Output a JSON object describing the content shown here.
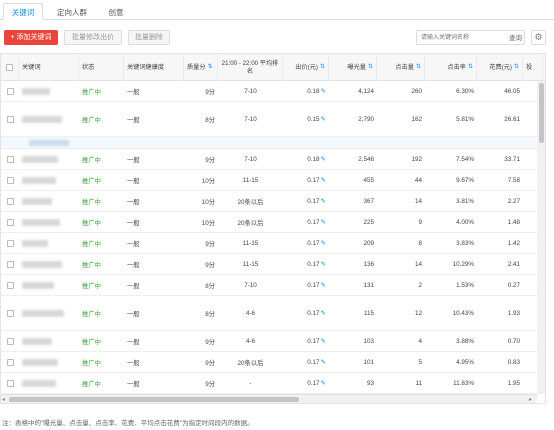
{
  "tabs": [
    {
      "label": "关键词",
      "active": true
    },
    {
      "label": "定向人群",
      "active": false
    },
    {
      "label": "创意",
      "active": false
    }
  ],
  "toolbar": {
    "add_label": "+ 添加关键词",
    "bid_label": "批量修改出价",
    "delete_label": "批量删除",
    "search_placeholder": "请输入关键词名称",
    "search_button": "查询",
    "settings_icon": "gear-icon"
  },
  "columns": {
    "keyword": "关键词",
    "status": "状态",
    "health": "关键词健康度",
    "quality": "质量分",
    "rank": "21:00 - 22:00 平均排名",
    "bid": "出价(元)",
    "impressions": "曝光量",
    "clicks": "点击量",
    "ctr": "点击率",
    "cost": "花费(元)",
    "more": "投"
  },
  "sort_icon": "⇅",
  "rows": [
    {
      "status": "推广中",
      "health": "一般",
      "quality": "9分",
      "rank": "7-10",
      "bid": "0.18",
      "impressions": "4,124",
      "clicks": "260",
      "ctr": "6.30%",
      "cost": "46.05"
    },
    {
      "status": "推广中",
      "health": "一般",
      "quality": "8分",
      "rank": "7-10",
      "bid": "0.15",
      "impressions": "2,790",
      "clicks": "162",
      "ctr": "5.81%",
      "cost": "26.61"
    },
    {
      "status": "推广中",
      "health": "一般",
      "quality": "9分",
      "rank": "7-10",
      "bid": "0.18",
      "impressions": "2,546",
      "clicks": "192",
      "ctr": "7.54%",
      "cost": "33.71"
    },
    {
      "status": "推广中",
      "health": "一般",
      "quality": "10分",
      "rank": "11-15",
      "bid": "0.17",
      "impressions": "455",
      "clicks": "44",
      "ctr": "9.67%",
      "cost": "7.58"
    },
    {
      "status": "推广中",
      "health": "一般",
      "quality": "10分",
      "rank": "20条以后",
      "bid": "0.17",
      "impressions": "367",
      "clicks": "14",
      "ctr": "3.81%",
      "cost": "2.27"
    },
    {
      "status": "推广中",
      "health": "一般",
      "quality": "10分",
      "rank": "20条以后",
      "bid": "0.17",
      "impressions": "225",
      "clicks": "9",
      "ctr": "4.00%",
      "cost": "1.48"
    },
    {
      "status": "推广中",
      "health": "一般",
      "quality": "9分",
      "rank": "11-15",
      "bid": "0.17",
      "impressions": "209",
      "clicks": "8",
      "ctr": "3.83%",
      "cost": "1.42"
    },
    {
      "status": "推广中",
      "health": "一般",
      "quality": "9分",
      "rank": "11-15",
      "bid": "0.17",
      "impressions": "136",
      "clicks": "14",
      "ctr": "10.29%",
      "cost": "2.41"
    },
    {
      "status": "推广中",
      "health": "一般",
      "quality": "8分",
      "rank": "7-10",
      "bid": "0.17",
      "impressions": "131",
      "clicks": "2",
      "ctr": "1.53%",
      "cost": "0.27"
    },
    {
      "status": "推广中",
      "health": "一般",
      "quality": "8分",
      "rank": "4-6",
      "bid": "0.17",
      "impressions": "115",
      "clicks": "12",
      "ctr": "10.43%",
      "cost": "1.93"
    },
    {
      "status": "推广中",
      "health": "一般",
      "quality": "9分",
      "rank": "4-6",
      "bid": "0.17",
      "impressions": "103",
      "clicks": "4",
      "ctr": "3.88%",
      "cost": "0.70"
    },
    {
      "status": "推广中",
      "health": "一般",
      "quality": "9分",
      "rank": "20条以后",
      "bid": "0.17",
      "impressions": "101",
      "clicks": "5",
      "ctr": "4.95%",
      "cost": "0.83"
    },
    {
      "status": "推广中",
      "health": "一般",
      "quality": "9分",
      "rank": "-",
      "bid": "0.17",
      "impressions": "93",
      "clicks": "11",
      "ctr": "11.83%",
      "cost": "1.95"
    }
  ],
  "footnote": "注：表格中的\"曝光量、点击量、点击率、花费、平均点击花费\"为指定时间段内的数据。",
  "colors": {
    "accent": "#1b8fe0",
    "danger": "#e8453c",
    "status": "#3aa53a"
  }
}
